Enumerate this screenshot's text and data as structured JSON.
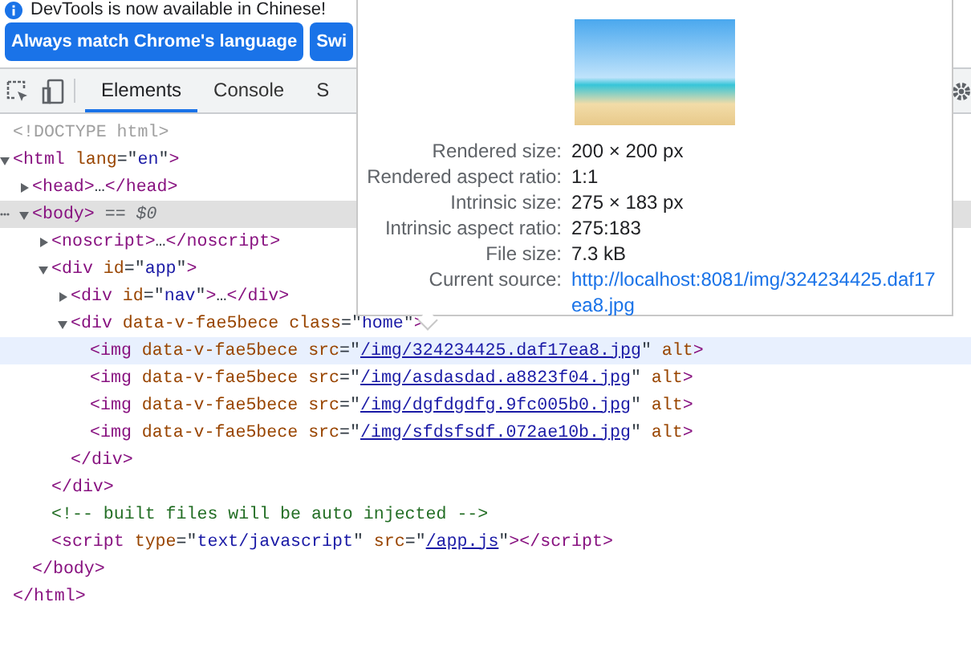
{
  "infobar": {
    "message": "DevTools is now available in Chinese!"
  },
  "buttons": [
    "Always match Chrome's language",
    "Swi"
  ],
  "tabs": [
    {
      "label": "Elements",
      "selected": true
    },
    {
      "label": "Console",
      "selected": false
    },
    {
      "label": "S",
      "selected": false
    }
  ],
  "tree": [
    {
      "open": [
        {
          "kind": "doctype",
          "text": "<!DOCTYPE html>"
        }
      ],
      "selected": false,
      "hovered": false
    },
    {
      "open": [
        {
          "kind": "tag",
          "text": "<html"
        },
        {
          "kind": "attr",
          "text": " lang"
        },
        {
          "kind": "punct",
          "text": "=\""
        },
        {
          "kind": "value",
          "text": "en"
        },
        {
          "kind": "punct",
          "text": "\""
        },
        {
          "kind": "tag",
          "text": ">"
        }
      ],
      "expanded": true,
      "selected": false,
      "hovered": false,
      "close": [
        {
          "kind": "tag",
          "text": "</html>"
        }
      ],
      "children": [
        {
          "open": [
            {
              "kind": "tag",
              "text": "<head>"
            },
            {
              "kind": "text",
              "text": "…"
            },
            {
              "kind": "tag",
              "text": "</head>"
            }
          ],
          "expanded": false,
          "selected": false,
          "hovered": false
        },
        {
          "open": [
            {
              "kind": "tag",
              "text": "<body>"
            },
            {
              "kind": "marker",
              "text": " == $0"
            }
          ],
          "expanded": true,
          "selected": true,
          "hovered": false,
          "close": [
            {
              "kind": "tag",
              "text": "</body>"
            }
          ],
          "children": [
            {
              "open": [
                {
                  "kind": "tag",
                  "text": "<noscript>"
                },
                {
                  "kind": "text",
                  "text": "…"
                },
                {
                  "kind": "tag",
                  "text": "</noscript>"
                }
              ],
              "expanded": false,
              "selected": false,
              "hovered": false
            },
            {
              "open": [
                {
                  "kind": "tag",
                  "text": "<div"
                },
                {
                  "kind": "attr",
                  "text": " id"
                },
                {
                  "kind": "punct",
                  "text": "=\""
                },
                {
                  "kind": "value",
                  "text": "app"
                },
                {
                  "kind": "punct",
                  "text": "\""
                },
                {
                  "kind": "tag",
                  "text": ">"
                }
              ],
              "expanded": true,
              "selected": false,
              "hovered": false,
              "close": [
                {
                  "kind": "tag",
                  "text": "</div>"
                }
              ],
              "children": [
                {
                  "open": [
                    {
                      "kind": "tag",
                      "text": "<div"
                    },
                    {
                      "kind": "attr",
                      "text": " id"
                    },
                    {
                      "kind": "punct",
                      "text": "=\""
                    },
                    {
                      "kind": "value",
                      "text": "nav"
                    },
                    {
                      "kind": "punct",
                      "text": "\""
                    },
                    {
                      "kind": "tag",
                      "text": ">"
                    },
                    {
                      "kind": "text",
                      "text": "…"
                    },
                    {
                      "kind": "tag",
                      "text": "</div>"
                    }
                  ],
                  "expanded": false,
                  "selected": false,
                  "hovered": false
                },
                {
                  "open": [
                    {
                      "kind": "tag",
                      "text": "<div"
                    },
                    {
                      "kind": "attr",
                      "text": " data-v-fae5bece"
                    },
                    {
                      "kind": "attr",
                      "text": " class"
                    },
                    {
                      "kind": "punct",
                      "text": "=\""
                    },
                    {
                      "kind": "value",
                      "text": "home"
                    },
                    {
                      "kind": "punct",
                      "text": "\""
                    },
                    {
                      "kind": "tag",
                      "text": ">"
                    }
                  ],
                  "expanded": true,
                  "selected": false,
                  "hovered": false,
                  "close": [
                    {
                      "kind": "tag",
                      "text": "</div>"
                    }
                  ],
                  "children": [
                    {
                      "open": [
                        {
                          "kind": "tag",
                          "text": "<img"
                        },
                        {
                          "kind": "attr",
                          "text": " data-v-fae5bece"
                        },
                        {
                          "kind": "attr",
                          "text": " src"
                        },
                        {
                          "kind": "punct",
                          "text": "=\""
                        },
                        {
                          "kind": "link",
                          "text": "/img/324234425.daf17ea8.jpg"
                        },
                        {
                          "kind": "punct",
                          "text": "\""
                        },
                        {
                          "kind": "attr",
                          "text": " alt"
                        },
                        {
                          "kind": "tag",
                          "text": ">"
                        }
                      ],
                      "selected": false,
                      "hovered": true
                    },
                    {
                      "open": [
                        {
                          "kind": "tag",
                          "text": "<img"
                        },
                        {
                          "kind": "attr",
                          "text": " data-v-fae5bece"
                        },
                        {
                          "kind": "attr",
                          "text": " src"
                        },
                        {
                          "kind": "punct",
                          "text": "=\""
                        },
                        {
                          "kind": "link",
                          "text": "/img/asdasdad.a8823f04.jpg"
                        },
                        {
                          "kind": "punct",
                          "text": "\""
                        },
                        {
                          "kind": "attr",
                          "text": " alt"
                        },
                        {
                          "kind": "tag",
                          "text": ">"
                        }
                      ],
                      "selected": false,
                      "hovered": false
                    },
                    {
                      "open": [
                        {
                          "kind": "tag",
                          "text": "<img"
                        },
                        {
                          "kind": "attr",
                          "text": " data-v-fae5bece"
                        },
                        {
                          "kind": "attr",
                          "text": " src"
                        },
                        {
                          "kind": "punct",
                          "text": "=\""
                        },
                        {
                          "kind": "link",
                          "text": "/img/dgfdgdfg.9fc005b0.jpg"
                        },
                        {
                          "kind": "punct",
                          "text": "\""
                        },
                        {
                          "kind": "attr",
                          "text": " alt"
                        },
                        {
                          "kind": "tag",
                          "text": ">"
                        }
                      ],
                      "selected": false,
                      "hovered": false
                    },
                    {
                      "open": [
                        {
                          "kind": "tag",
                          "text": "<img"
                        },
                        {
                          "kind": "attr",
                          "text": " data-v-fae5bece"
                        },
                        {
                          "kind": "attr",
                          "text": " src"
                        },
                        {
                          "kind": "punct",
                          "text": "=\""
                        },
                        {
                          "kind": "link",
                          "text": "/img/sfdsfsdf.072ae10b.jpg"
                        },
                        {
                          "kind": "punct",
                          "text": "\""
                        },
                        {
                          "kind": "attr",
                          "text": " alt"
                        },
                        {
                          "kind": "tag",
                          "text": ">"
                        }
                      ],
                      "selected": false,
                      "hovered": false
                    }
                  ]
                }
              ]
            },
            {
              "open": [
                {
                  "kind": "comment",
                  "text": "<!-- built files will be auto injected -->"
                }
              ],
              "selected": false,
              "hovered": false
            },
            {
              "open": [
                {
                  "kind": "tag",
                  "text": "<script"
                },
                {
                  "kind": "attr",
                  "text": " type"
                },
                {
                  "kind": "punct",
                  "text": "=\""
                },
                {
                  "kind": "value",
                  "text": "text/javascript"
                },
                {
                  "kind": "punct",
                  "text": "\""
                },
                {
                  "kind": "attr",
                  "text": " src"
                },
                {
                  "kind": "punct",
                  "text": "=\""
                },
                {
                  "kind": "link",
                  "text": "/app.js"
                },
                {
                  "kind": "punct",
                  "text": "\""
                },
                {
                  "kind": "tag",
                  "text": "></script>"
                }
              ],
              "selected": false,
              "hovered": false
            }
          ]
        }
      ]
    }
  ],
  "image_preview": {
    "rows": [
      {
        "label": "Rendered size:",
        "value": "200 × 200 px",
        "kind": "text"
      },
      {
        "label": "Rendered aspect ratio:",
        "value": "1:1",
        "kind": "text"
      },
      {
        "label": "Intrinsic size:",
        "value": "275 × 183 px",
        "kind": "text"
      },
      {
        "label": "Intrinsic aspect ratio:",
        "value": "275:183",
        "kind": "text"
      },
      {
        "label": "File size:",
        "value": "7.3 kB",
        "kind": "text"
      },
      {
        "label": "Current source:",
        "value": "http://localhost:8081/img/324234425.daf17ea8.jpg",
        "kind": "link"
      }
    ]
  }
}
